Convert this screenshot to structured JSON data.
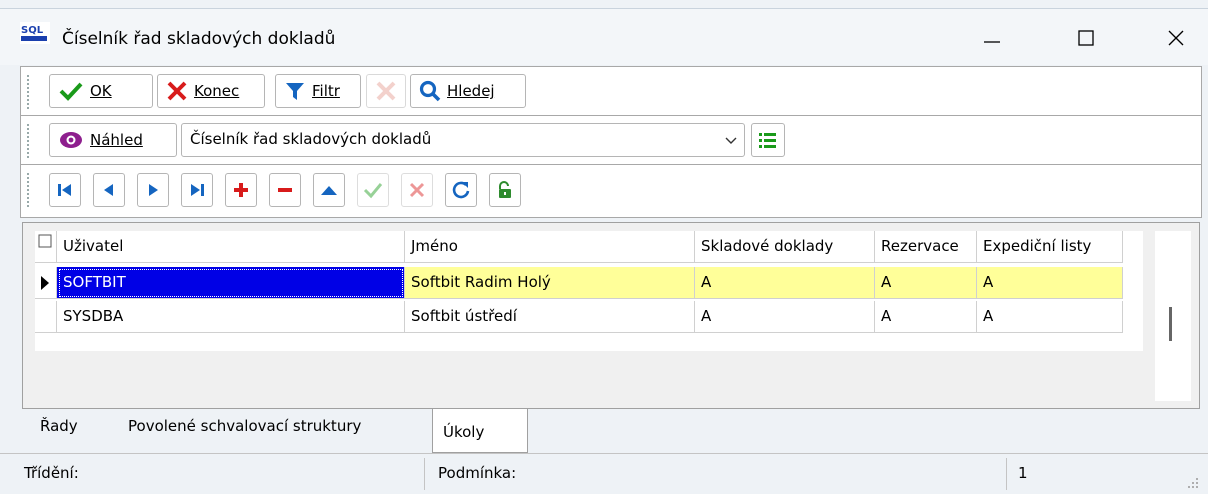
{
  "window": {
    "title": "Číselník řad skladových dokladů",
    "icon": "sql-app-icon",
    "controls": [
      "minimize",
      "maximize",
      "close"
    ]
  },
  "toolbar1": {
    "ok": "OK",
    "konec": "Konec",
    "filtr": "Filtr",
    "hledej": "Hledej"
  },
  "toolbar2": {
    "nahled": "Náhled",
    "view_select": "Číselník řad skladových dokladů"
  },
  "navigator": [
    "first",
    "prior",
    "next",
    "last",
    "insert",
    "delete",
    "edit",
    "post",
    "cancel",
    "refresh",
    "unlock"
  ],
  "grid": {
    "columns": [
      "Uživatel",
      "Jméno",
      "Skladové doklady",
      "Rezervace",
      "Expediční listy"
    ],
    "rows": [
      [
        "SOFTBIT",
        "Softbit Radim Holý",
        "A",
        "A",
        "A"
      ],
      [
        "SYSDBA",
        "Softbit ústředí",
        "A",
        "A",
        "A"
      ]
    ]
  },
  "tabs": [
    "Řady",
    "Povolené schvalovací struktury",
    "Úkoly"
  ],
  "active_tab": "Úkoly",
  "status": {
    "trideni": "Třídění:",
    "podminka": "Podmínka:",
    "count": "1"
  },
  "colors": {
    "selected": "#0000e6",
    "row_highlight": "#ffff99",
    "ok_green": "#1a9a1a",
    "cancel_red": "#d81b1b",
    "filter_blue": "#1565c0",
    "eye_purple": "#8e1f8e"
  }
}
